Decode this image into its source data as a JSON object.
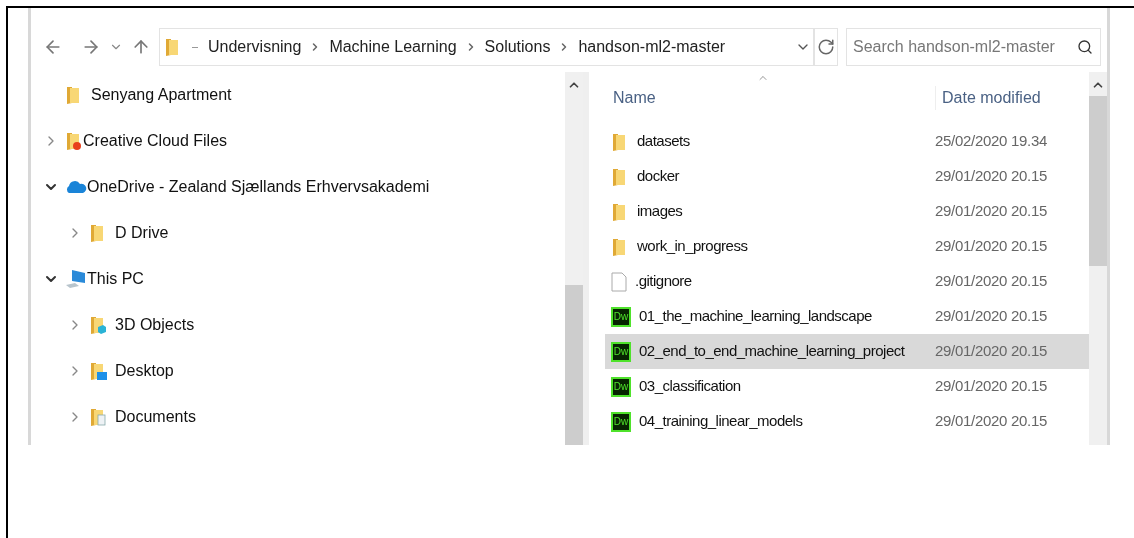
{
  "address_bar": {
    "breadcrumbs": [
      "Undervisning",
      "Machine Learning",
      "Solutions",
      "handson-ml2-master"
    ]
  },
  "search": {
    "placeholder": "Search handson-ml2-master"
  },
  "navigation_pane": {
    "items": [
      {
        "label": "Senyang Apartment",
        "kind": "folder"
      },
      {
        "label": "Creative Cloud Files",
        "kind": "cloud-files",
        "expanded": false
      },
      {
        "label": "OneDrive - Zealand Sjællands Erhvervsakademi",
        "kind": "onedrive",
        "expanded": true,
        "children": [
          {
            "label": "D Drive",
            "kind": "folder",
            "expanded": false
          }
        ]
      },
      {
        "label": "This PC",
        "kind": "pc",
        "expanded": true,
        "children": [
          {
            "label": "3D Objects",
            "kind": "objects",
            "expanded": false
          },
          {
            "label": "Desktop",
            "kind": "desktop",
            "expanded": false
          },
          {
            "label": "Documents",
            "kind": "documents",
            "expanded": false
          }
        ]
      }
    ]
  },
  "file_list": {
    "columns": [
      "Name",
      "Date modified"
    ],
    "rows": [
      {
        "name": "datasets",
        "kind": "folder",
        "date_modified": "25/02/2020 19.34",
        "selected": false
      },
      {
        "name": "docker",
        "kind": "folder",
        "date_modified": "29/01/2020 20.15",
        "selected": false
      },
      {
        "name": "images",
        "kind": "folder",
        "date_modified": "29/01/2020 20.15",
        "selected": false
      },
      {
        "name": "work_in_progress",
        "kind": "folder",
        "date_modified": "29/01/2020 20.15",
        "selected": false
      },
      {
        "name": ".gitignore",
        "kind": "file",
        "date_modified": "29/01/2020 20.15",
        "selected": false
      },
      {
        "name": "01_the_machine_learning_landscape",
        "kind": "app-file",
        "icon_text": "Dw",
        "date_modified": "29/01/2020 20.15",
        "selected": false
      },
      {
        "name": "02_end_to_end_machine_learning_project",
        "kind": "app-file",
        "icon_text": "Dw",
        "date_modified": "29/01/2020 20.15",
        "selected": true
      },
      {
        "name": "03_classification",
        "kind": "app-file",
        "icon_text": "Dw",
        "date_modified": "29/01/2020 20.15",
        "selected": false
      },
      {
        "name": "04_training_linear_models",
        "kind": "app-file",
        "icon_text": "Dw",
        "date_modified": "29/01/2020 20.15",
        "selected": false
      }
    ]
  }
}
